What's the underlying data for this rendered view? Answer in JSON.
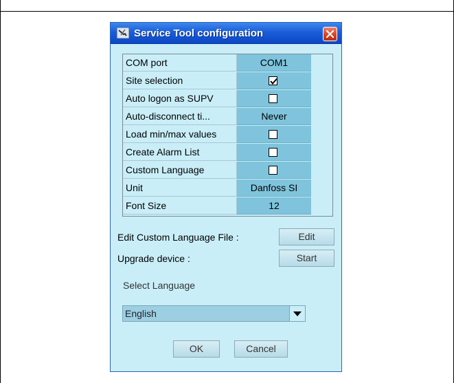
{
  "dialog": {
    "title": "Service Tool configuration",
    "icon": "wrench-screwdriver-icon",
    "close_icon": "close-icon"
  },
  "settings": [
    {
      "name": "COM port",
      "type": "text",
      "value": "COM1"
    },
    {
      "name": "Site selection",
      "type": "checkbox",
      "checked": true
    },
    {
      "name": "Auto logon as SUPV",
      "type": "checkbox",
      "checked": false
    },
    {
      "name": "Auto-disconnect ti...",
      "type": "text",
      "value": "Never"
    },
    {
      "name": "Load min/max values",
      "type": "checkbox",
      "checked": false
    },
    {
      "name": "Create Alarm List",
      "type": "checkbox",
      "checked": false
    },
    {
      "name": "Custom Language",
      "type": "checkbox",
      "checked": false
    },
    {
      "name": "Unit",
      "type": "text",
      "value": "Danfoss SI"
    },
    {
      "name": "Font Size",
      "type": "text",
      "value": "12"
    }
  ],
  "actions": {
    "edit_label": "Edit Custom Language File :",
    "edit_button": "Edit",
    "upgrade_label": "Upgrade device :",
    "upgrade_button": "Start"
  },
  "language": {
    "label": "Select Language",
    "selected": "English"
  },
  "footer": {
    "ok": "OK",
    "cancel": "Cancel"
  },
  "colors": {
    "dialog_bg": "#c9eef8",
    "value_cell": "#7fc4dc",
    "titlebar": "#1b5ed8",
    "close": "#d2401f"
  }
}
